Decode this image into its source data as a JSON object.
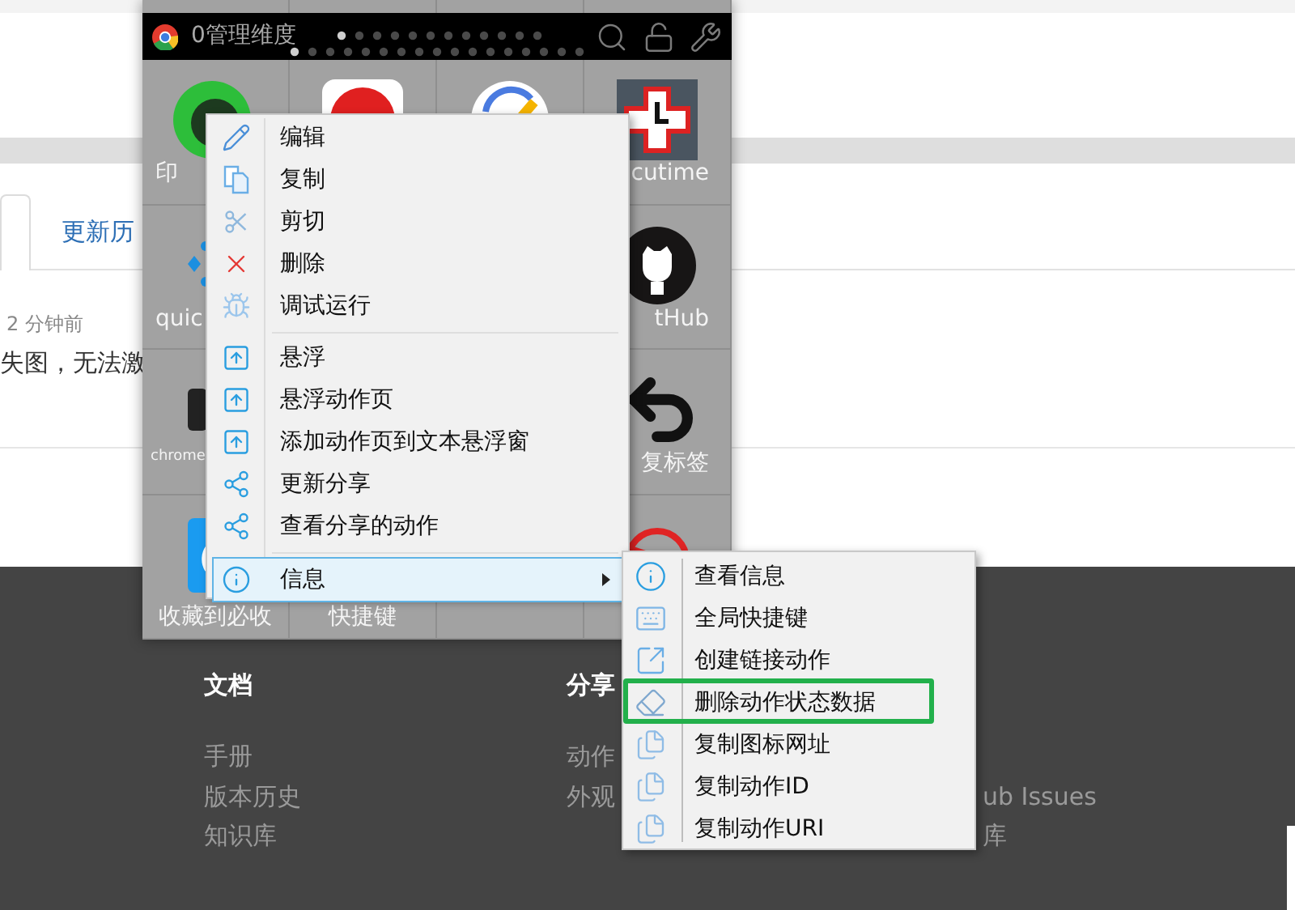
{
  "page": {
    "tabs": [
      {
        "selected": true
      },
      {
        "label": "更新历",
        "selected": false
      }
    ],
    "time": "2 分钟前",
    "text": "失图，无法激"
  },
  "footer": {
    "columns": [
      {
        "heading": "文档",
        "links": [
          "手册",
          "版本历史",
          "知识库"
        ]
      },
      {
        "heading": "分享",
        "links": [
          "动作",
          "外观"
        ]
      },
      {
        "links": [
          "ub Issues",
          "库"
        ]
      }
    ]
  },
  "popup": {
    "title": "0管理维度",
    "apps": [
      {
        "label": "印"
      },
      {
        "label": "cutime"
      },
      {
        "label": "quic"
      },
      {
        "label": "tHub"
      },
      {
        "label": "chrome"
      },
      {
        "label": "复标签"
      },
      {
        "label": "收藏到必收"
      },
      {
        "label": "快捷键"
      }
    ]
  },
  "menu": {
    "items": [
      {
        "kind": "item",
        "label": "编辑",
        "selected": false,
        "submenu": false
      },
      {
        "kind": "item",
        "label": "复制",
        "selected": false,
        "submenu": false
      },
      {
        "kind": "item",
        "label": "剪切",
        "selected": false,
        "submenu": false
      },
      {
        "kind": "item",
        "label": "删除",
        "selected": false,
        "submenu": false
      },
      {
        "kind": "item",
        "label": "调试运行",
        "selected": false,
        "submenu": false
      },
      {
        "kind": "separator"
      },
      {
        "kind": "item",
        "label": "悬浮",
        "selected": false,
        "submenu": false
      },
      {
        "kind": "item",
        "label": "悬浮动作页",
        "selected": false,
        "submenu": false
      },
      {
        "kind": "item",
        "label": "添加动作页到文本悬浮窗",
        "selected": false,
        "submenu": false
      },
      {
        "kind": "item",
        "label": "更新分享",
        "selected": false,
        "submenu": false
      },
      {
        "kind": "item",
        "label": "查看分享的动作",
        "selected": false,
        "submenu": false
      },
      {
        "kind": "separator"
      },
      {
        "kind": "item",
        "label": "信息",
        "selected": true,
        "submenu": true
      }
    ]
  },
  "submenu": {
    "items": [
      {
        "label": "查看信息",
        "highlighted": false
      },
      {
        "label": "全局快捷键",
        "highlighted": false
      },
      {
        "label": "创建链接动作",
        "highlighted": false
      },
      {
        "label": "删除动作状态数据",
        "highlighted": true
      },
      {
        "label": "复制图标网址",
        "highlighted": false
      },
      {
        "label": "复制动作ID",
        "highlighted": false
      },
      {
        "label": "复制动作URI",
        "highlighted": false
      }
    ]
  }
}
